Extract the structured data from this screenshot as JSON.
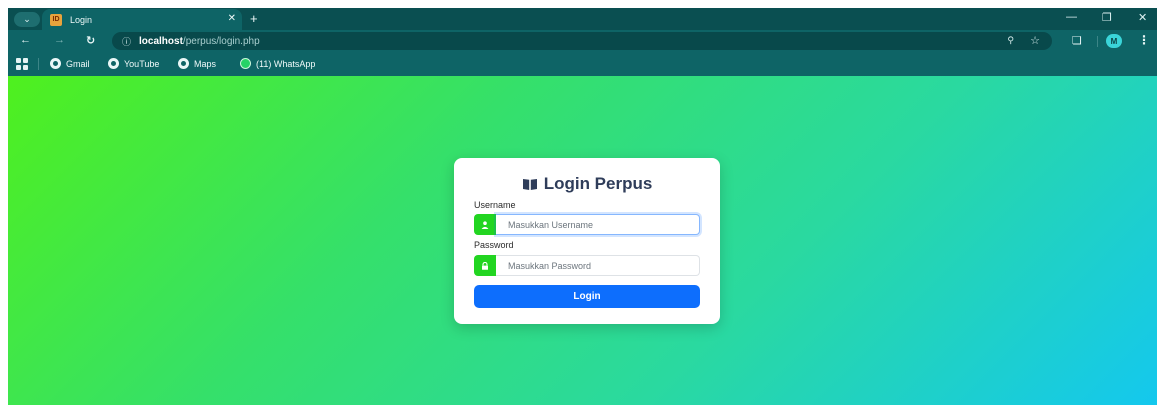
{
  "browser": {
    "tab": {
      "title": "Login",
      "favicon_text": "ID"
    },
    "url_host": "localhost",
    "url_path": "/perpus/login.php",
    "avatar_letter": "M",
    "bookmarks": [
      {
        "label": "Gmail"
      },
      {
        "label": "YouTube"
      },
      {
        "label": "Maps"
      },
      {
        "label": "(11) WhatsApp"
      }
    ]
  },
  "login": {
    "title": "Login Perpus",
    "username_label": "Username",
    "username_placeholder": "Masukkan Username",
    "password_label": "Password",
    "password_placeholder": "Masukkan Password",
    "submit_label": "Login"
  },
  "colors": {
    "accent": "#0d6efd",
    "addon": "#22d521",
    "gradient_start": "#4ff01e",
    "gradient_end": "#14c8ee",
    "browser_frame": "#0e6466"
  },
  "icons": [
    "chevron-down-icon",
    "close-icon",
    "plus-icon",
    "minimize-icon",
    "restore-icon",
    "back-icon",
    "forward-icon",
    "reload-icon",
    "info-icon",
    "zoom-icon",
    "star-icon",
    "extensions-icon",
    "kebab-menu-icon",
    "apps-icon",
    "globe-icon",
    "whatsapp-icon",
    "book-icon",
    "user-icon",
    "lock-icon"
  ]
}
